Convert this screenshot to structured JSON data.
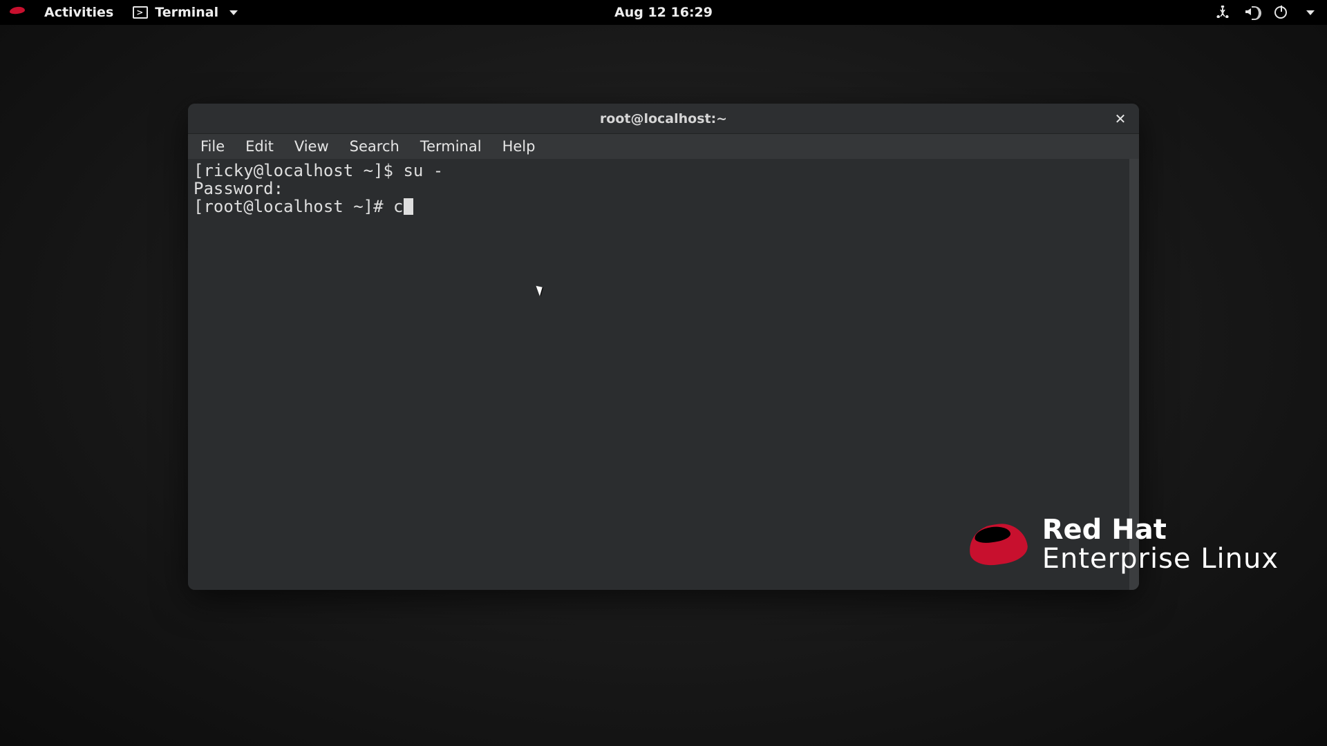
{
  "topbar": {
    "activities": "Activities",
    "app_name": "Terminal",
    "clock": "Aug 12  16:29"
  },
  "window": {
    "title": "root@localhost:~",
    "menu": {
      "file": "File",
      "edit": "Edit",
      "view": "View",
      "search": "Search",
      "terminal": "Terminal",
      "help": "Help"
    }
  },
  "terminal": {
    "lines": [
      {
        "prompt": "[ricky@localhost ~]$ ",
        "cmd": "su -"
      },
      {
        "prompt": "Password:",
        "cmd": ""
      },
      {
        "prompt": "[root@localhost ~]# ",
        "cmd": "c",
        "cursor": true
      }
    ]
  },
  "branding": {
    "line1": "Red Hat",
    "line2": "Enterprise Linux"
  }
}
